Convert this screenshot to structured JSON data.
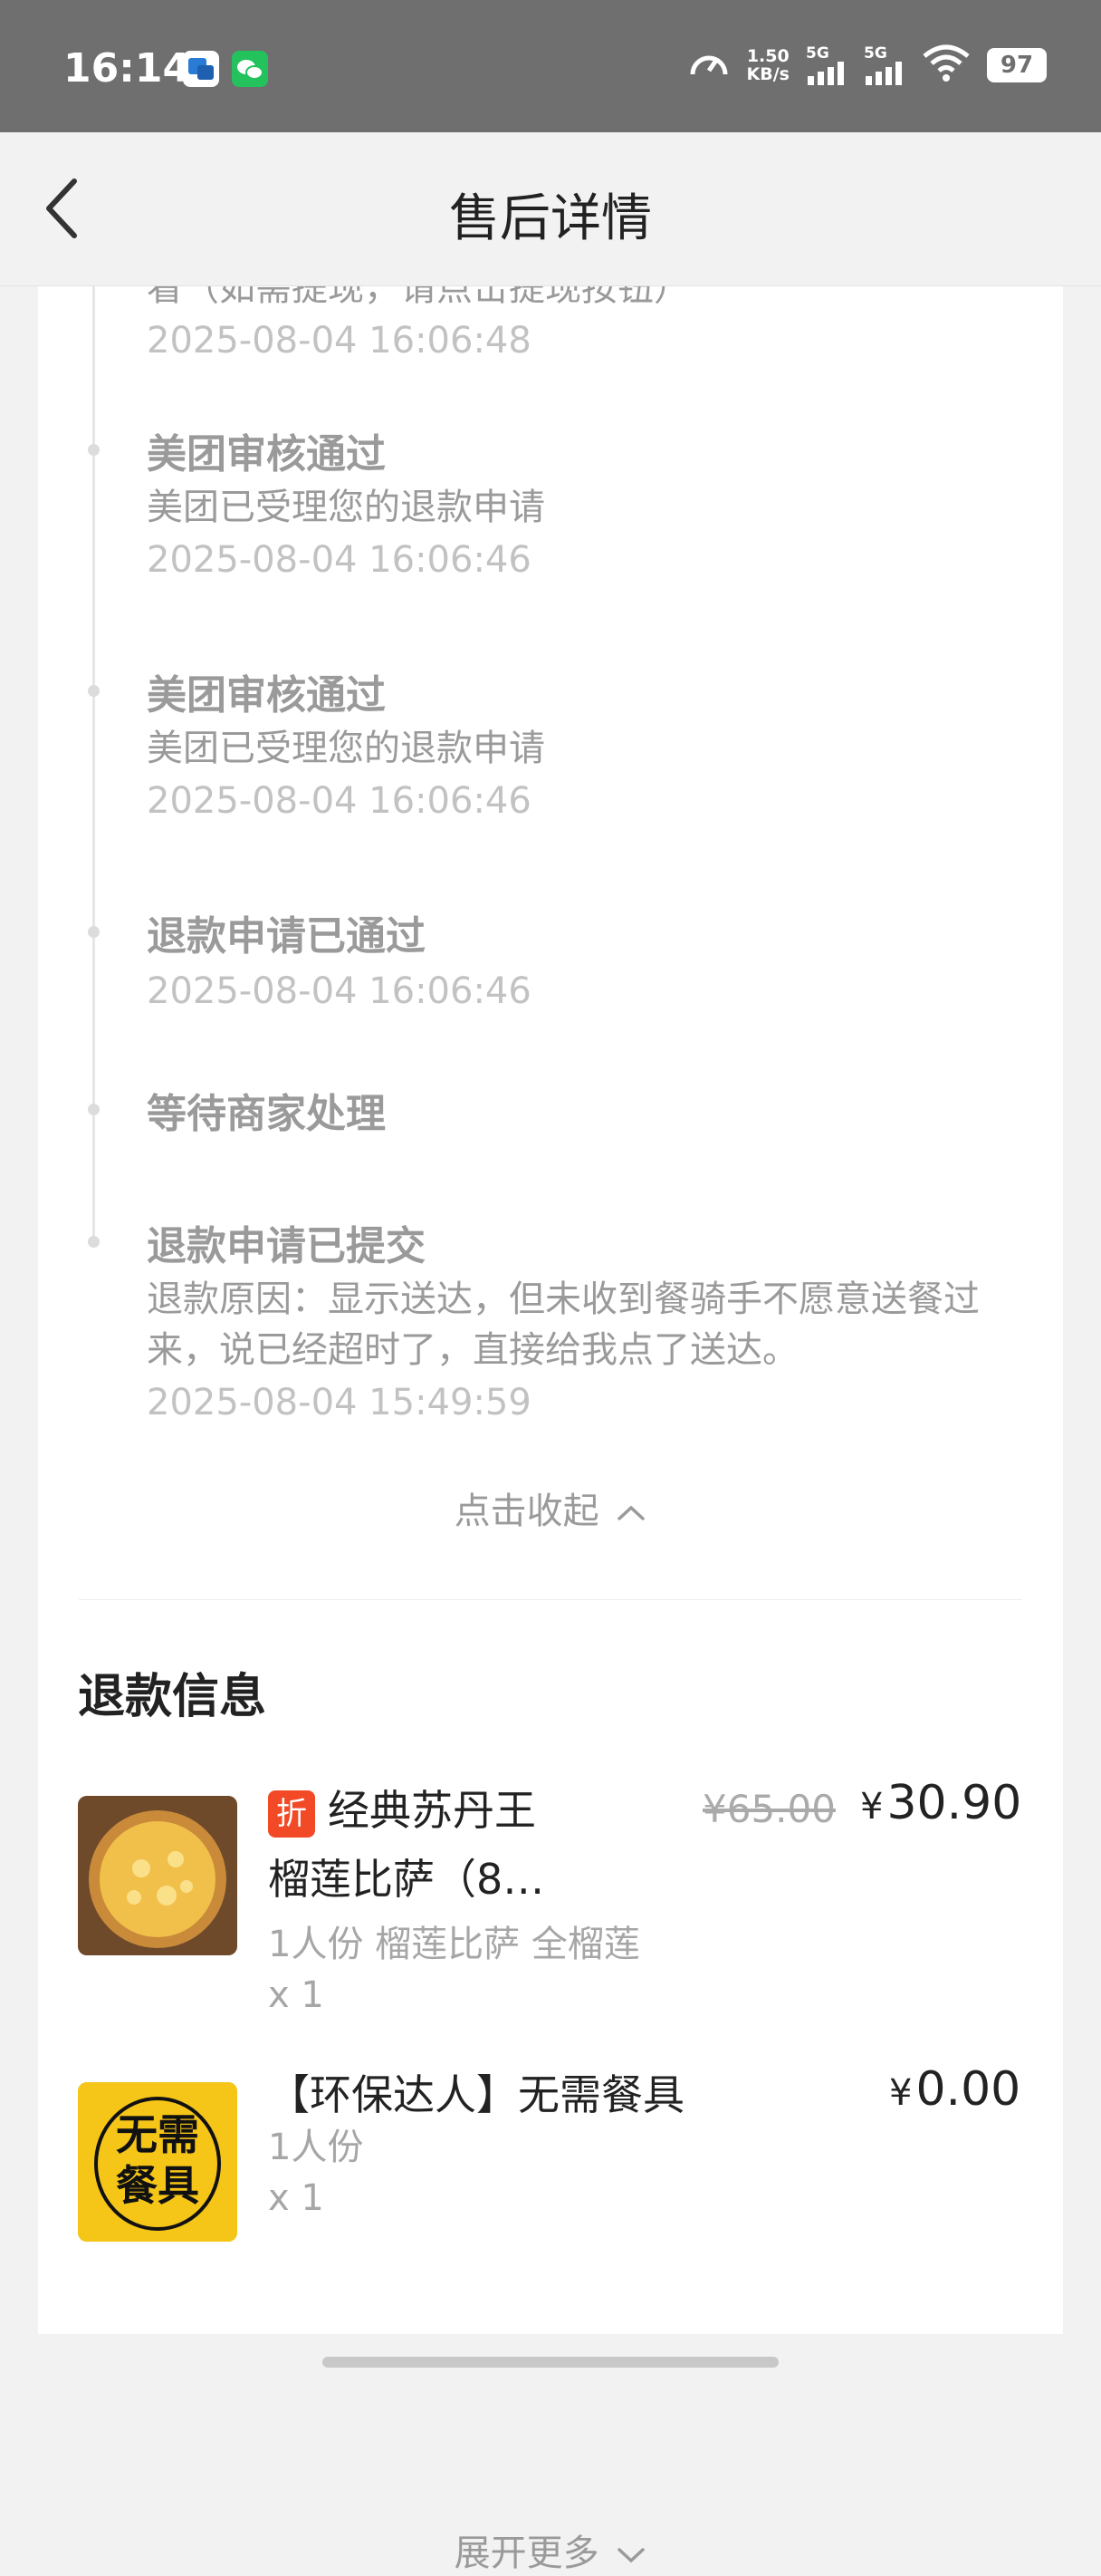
{
  "status_bar": {
    "time": "16:14",
    "net_speed_value": "1.50",
    "net_speed_unit": "KB/s",
    "signal_1": "5G",
    "signal_2": "5G",
    "battery": "97"
  },
  "nav": {
    "title": "售后详情",
    "back_icon": "chevron-left-icon"
  },
  "timeline": {
    "partial_item": {
      "desc": "看（如需提现，请点击提现按钮）",
      "time": "2025-08-04 16:06:48"
    },
    "items": [
      {
        "title": "美团审核通过",
        "desc": "美团已受理您的退款申请",
        "time": "2025-08-04 16:06:46"
      },
      {
        "title": "美团审核通过",
        "desc": "美团已受理您的退款申请",
        "time": "2025-08-04 16:06:46"
      },
      {
        "title": "退款申请已通过",
        "desc": "",
        "time": "2025-08-04 16:06:46"
      },
      {
        "title": "等待商家处理",
        "desc": "",
        "time": ""
      },
      {
        "title": "退款申请已提交",
        "desc": "退款原因：显示送达，但未收到餐骑手不愿意送餐过来，说已经超时了，直接给我点了送达。",
        "time": "2025-08-04 15:49:59"
      }
    ],
    "collapse_label": "点击收起"
  },
  "refund_info": {
    "section_title": "退款信息",
    "items": [
      {
        "badge": "折",
        "name_line1": "经典苏丹王",
        "name_line2": "榴莲比萨（8…",
        "spec": "1人份 榴莲比萨 全榴莲",
        "qty": "x 1",
        "price_old": "¥65.00",
        "price_currency": "¥",
        "price_new": "30.90"
      },
      {
        "name": "【环保达人】无需餐具",
        "spec": "1人份",
        "qty": "x 1",
        "price_currency": "¥",
        "price_new": "0.00",
        "image_text": "无需餐具"
      }
    ],
    "expand_label": "展开更多"
  },
  "colors": {
    "accent_discount": "#f24a26",
    "status_bar": "#6f6f6f",
    "timeline_text": "#9a9a9a",
    "card_bg": "#ffffff"
  }
}
